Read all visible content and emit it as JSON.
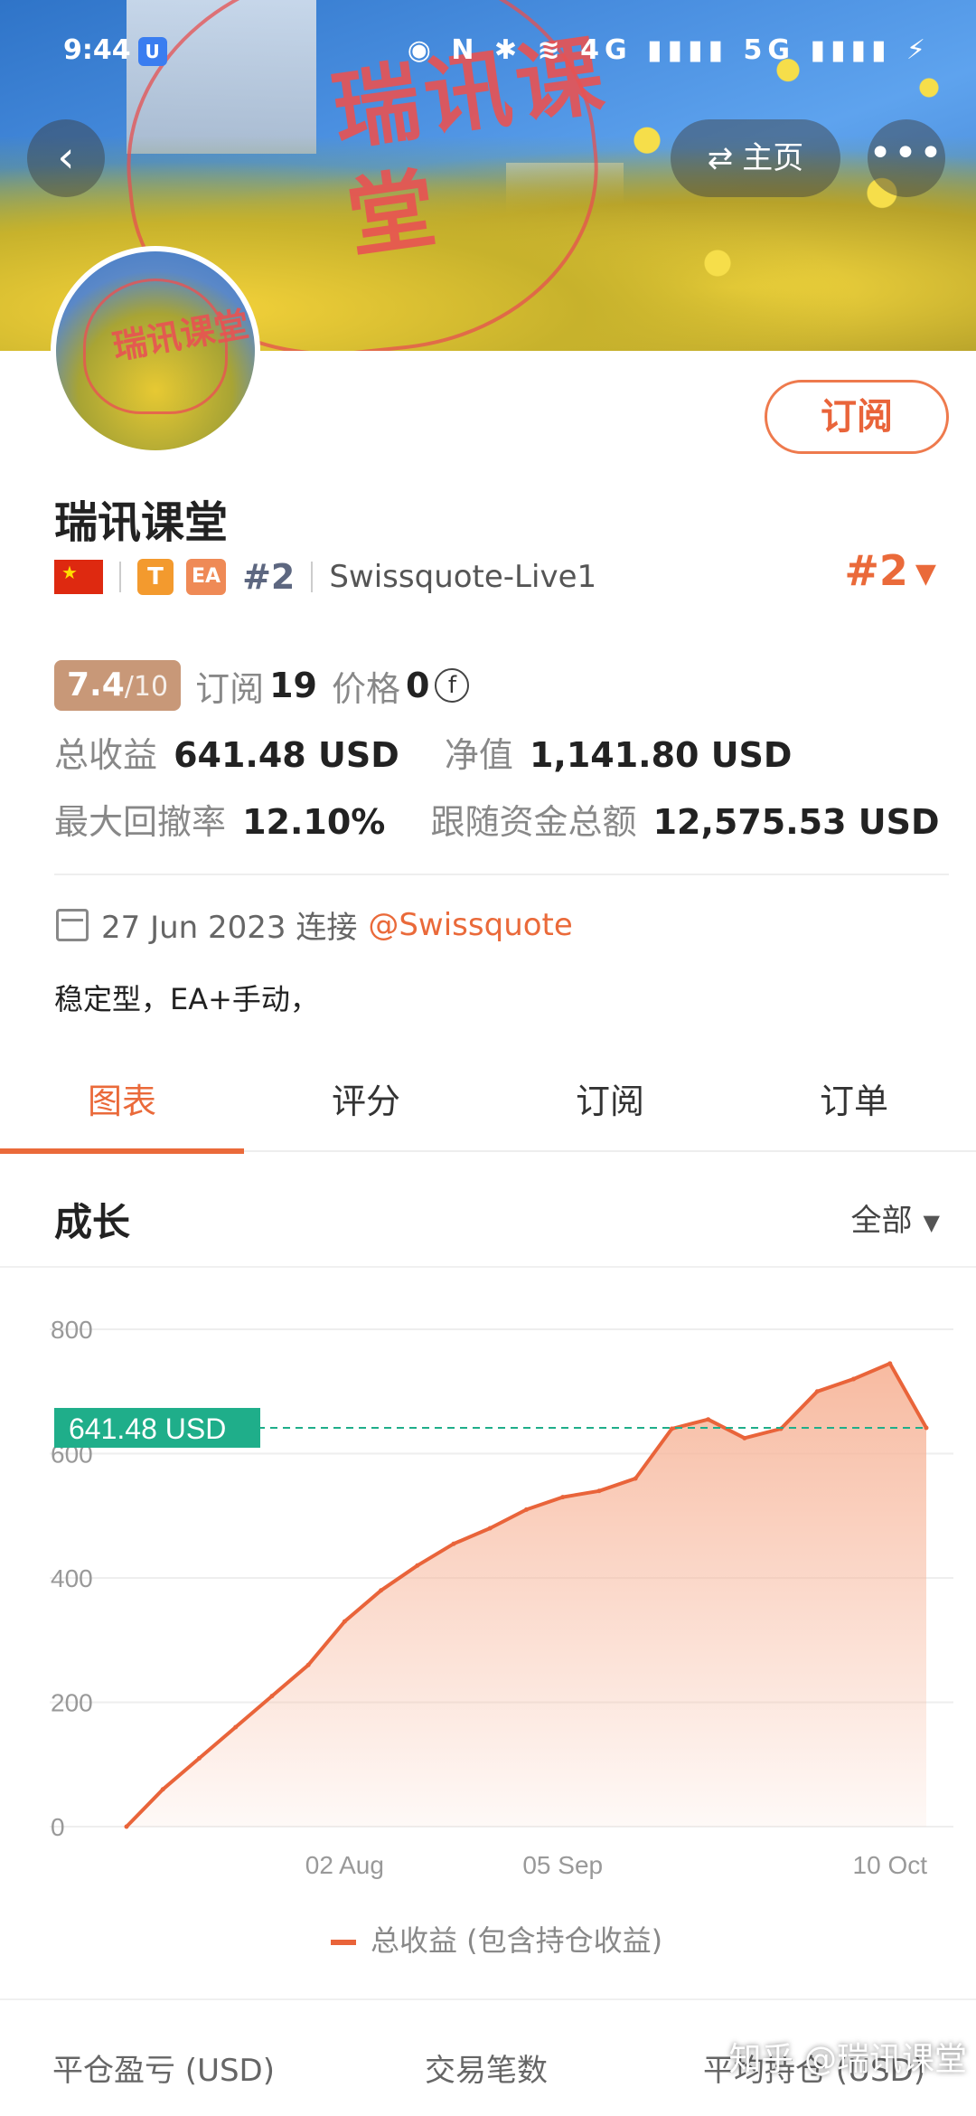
{
  "status_bar": {
    "time": "9:44",
    "icons": "◉ N ✱ ≋ 4G ▮▮▮▮ 5G ▮▮▮▮ ⚡"
  },
  "header": {
    "stamp_text": "瑞讯课堂",
    "home_label": "主页",
    "home_icon": "swap-arrows-icon",
    "more_icon": "more-dots-icon",
    "back_icon": "chevron-left-icon"
  },
  "profile": {
    "subscribe_label": "订阅",
    "name": "瑞讯课堂",
    "tag_t": "T",
    "tag_ea": "EA",
    "rank_small": "#2",
    "account": "Swissquote-Live1",
    "rank_big": "#2"
  },
  "stats": {
    "score": "7.4",
    "score_den": "/10",
    "subs_label": "订阅",
    "subs_value": "19",
    "price_label": "价格",
    "price_value": "0",
    "total_label": "总收益",
    "total_value": "641.48 USD",
    "equity_label": "净值",
    "equity_value": "1,141.80 USD",
    "drawdown_label": "最大回撤率",
    "drawdown_value": "12.10%",
    "follow_label": "跟随资金总额",
    "follow_value": "12,575.53 USD"
  },
  "since": {
    "date_text": "27 Jun 2023 连接",
    "broker_link": "@Swissquote"
  },
  "description": "稳定型，EA+手动，",
  "tabs": [
    {
      "label": "图表",
      "active": true
    },
    {
      "label": "评分",
      "active": false
    },
    {
      "label": "订阅",
      "active": false
    },
    {
      "label": "订单",
      "active": false
    }
  ],
  "growth": {
    "title": "成长",
    "range_label": "全部"
  },
  "chart_data": {
    "type": "area",
    "ylim": [
      0,
      800
    ],
    "yticks": [
      "800",
      "600",
      "400",
      "200",
      "0"
    ],
    "xticks": [
      "02 Aug",
      "05 Sep",
      "10 Oct"
    ],
    "current_label": "641.48 USD",
    "current_value": 641.48,
    "legend": "总收益 (包含持仓收益)",
    "colors": {
      "line": "#e9643a",
      "fill": "#f7b79c",
      "marker": "#1fae8a"
    },
    "series": [
      {
        "x": [
          "27 Jun",
          "02 Jul",
          "08 Jul",
          "14 Jul",
          "20 Jul",
          "26 Jul",
          "02 Aug",
          "08 Aug",
          "14 Aug",
          "20 Aug",
          "26 Aug",
          "01 Sep",
          "05 Sep",
          "09 Sep",
          "13 Sep",
          "17 Sep",
          "21 Sep",
          "25 Sep",
          "29 Sep",
          "03 Oct",
          "07 Oct",
          "10 Oct",
          "12 Oct"
        ],
        "values": [
          0,
          60,
          110,
          160,
          210,
          260,
          330,
          380,
          420,
          455,
          480,
          510,
          530,
          540,
          560,
          640,
          655,
          625,
          640,
          700,
          720,
          745,
          641.48
        ]
      }
    ]
  },
  "footer": {
    "col1": "平仓盈亏 (USD)",
    "col2": "交易笔数",
    "col3": "平均持仓 (USD)"
  },
  "watermark": "知乎 @瑞讯课堂"
}
